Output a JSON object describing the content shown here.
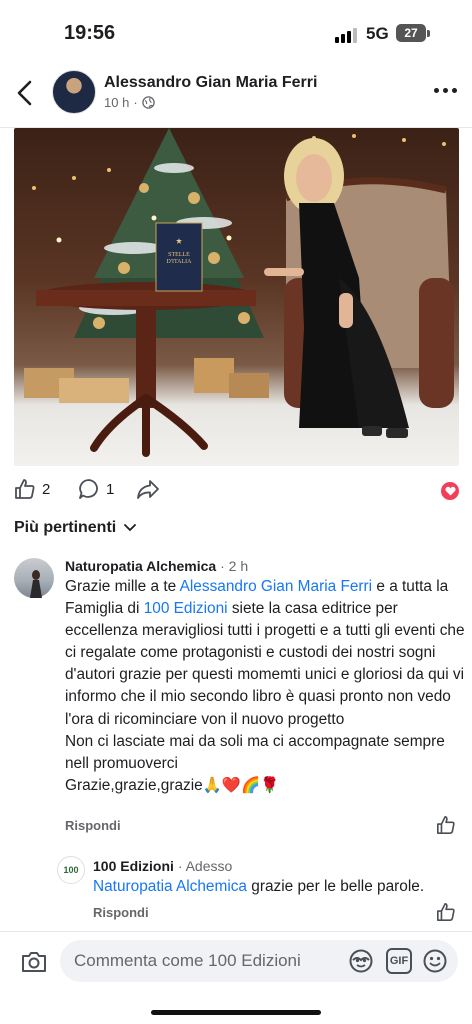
{
  "status_bar": {
    "time": "19:56",
    "network": "5G",
    "battery": "27"
  },
  "post": {
    "author": "Alessandro Gian Maria Ferri",
    "time": "10 h",
    "photo": {
      "book_title_line1": "STELLE",
      "book_title_line2": "D'ITALIA"
    },
    "likes": "2",
    "comments": "1"
  },
  "sort_label": "Più pertinenti",
  "comment": {
    "author": "Naturopatia Alchemica",
    "time": "2 h",
    "text_1": "Grazie mille a te ",
    "mention_1": "Alessandro Gian Maria Ferri",
    "text_2": " e a tutta la Famiglia di ",
    "mention_2": "100 Edizioni",
    "text_3": " siete la casa editrice per eccellenza meravigliosi tutti i progetti e a tutti gli eventi che ci regalate come protagonisti e custodi dei nostri sogni d'autori grazie per questi momemti unici e gloriosi da qui vi informo che il mio secondo libro è quasi pronto non vedo l'ora di ricominciare von il nuovo progetto",
    "text_4": "Non ci lasciate mai da soli ma ci accompagnate sempre nell promuoverci",
    "text_5": "Grazie,grazie,grazie🙏❤️🌈🌹",
    "reply_label": "Rispondi"
  },
  "reply": {
    "author": "100 Edizioni",
    "avatar_text": "100",
    "time": "Adesso",
    "mention": "Naturopatia Alchemica",
    "text": " grazie per le belle parole.",
    "reply_label": "Rispondi"
  },
  "composer": {
    "placeholder": "Commenta come 100 Edizioni",
    "gif_label": "GIF"
  },
  "colors": {
    "link": "#1877f2",
    "heart": "#f33e58"
  }
}
